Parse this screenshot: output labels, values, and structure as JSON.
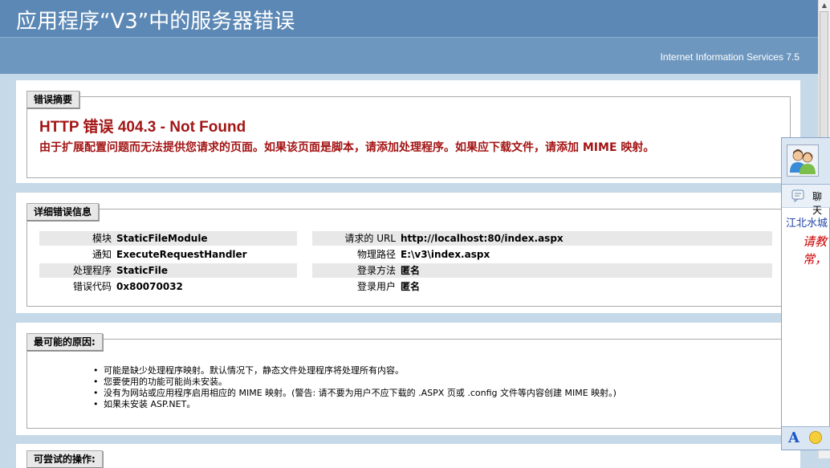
{
  "header": {
    "title": "应用程序“V3”中的服务器错误",
    "server": "Internet Information Services 7.5"
  },
  "summary": {
    "legend": "错误摘要",
    "error_title": "HTTP 错误 404.3 - Not Found",
    "error_desc": "由于扩展配置问题而无法提供您请求的页面。如果该页面是脚本，请添加处理程序。如果应下载文件，请添加 MIME 映射。"
  },
  "details": {
    "legend": "详细错误信息",
    "left": [
      {
        "label": "模块",
        "value": "StaticFileModule"
      },
      {
        "label": "通知",
        "value": "ExecuteRequestHandler"
      },
      {
        "label": "处理程序",
        "value": "StaticFile"
      },
      {
        "label": "错误代码",
        "value": "0x80070032"
      }
    ],
    "right": [
      {
        "label": "请求的 URL",
        "value": "http://localhost:80/index.aspx"
      },
      {
        "label": "物理路径",
        "value": "E:\\v3\\index.aspx"
      },
      {
        "label": "登录方法",
        "value": "匿名"
      },
      {
        "label": "登录用户",
        "value": "匿名"
      }
    ]
  },
  "causes": {
    "legend": "最可能的原因:",
    "items": [
      "可能是缺少处理程序映射。默认情况下，静态文件处理程序将处理所有内容。",
      "您要使用的功能可能尚未安装。",
      "没有为网站或应用程序启用相应的 MIME 映射。(警告: 请不要为用户不应下载的 .ASPX 页或 .config 文件等内容创建 MIME 映射。)",
      "如果未安装 ASP.NET。"
    ]
  },
  "actions": {
    "legend": "可尝试的操作:"
  },
  "chat_widget": {
    "chat_label": "聊天",
    "location": "江北水城",
    "message_line1": "请教",
    "message_line2": "常，",
    "font_button": "A",
    "avatar_icon": "user-group-icon",
    "emoji_icon": "smiley-icon"
  }
}
